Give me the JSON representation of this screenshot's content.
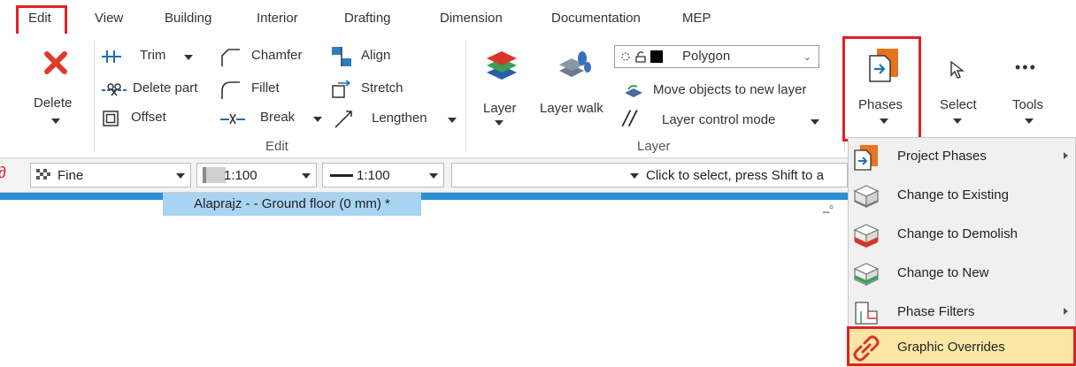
{
  "tabs": [
    "Edit",
    "View",
    "Building",
    "Interior",
    "Drafting",
    "Dimension",
    "Documentation",
    "MEP"
  ],
  "ribbon": {
    "delete_label": "Delete",
    "trim": "Trim",
    "delete_part": "Delete part",
    "offset": "Offset",
    "chamfer": "Chamfer",
    "fillet": "Fillet",
    "break": "Break",
    "align": "Align",
    "stretch": "Stretch",
    "lengthen": "Lengthen",
    "edit_group": "Edit",
    "layer": "Layer",
    "layer_walk": "Layer walk",
    "polygon": "Polygon",
    "move_objects": "Move objects to new layer",
    "layer_control": "Layer control mode",
    "layer_group": "Layer",
    "phases": "Phases",
    "select": "Select",
    "tools": "Tools",
    "tools_dots": "•••"
  },
  "toolbar": {
    "quality": "Fine",
    "scale1": "1:100",
    "scale2": "1:100",
    "blank": "",
    "hint": "Click to select, press Shift to a"
  },
  "view_tab": "Alaprajz -  - Ground floor (0 mm) *",
  "menu": {
    "items": [
      {
        "label": "Project Phases",
        "icon": "project-phases-icon",
        "submenu": true
      },
      {
        "label": "Change to Existing",
        "icon": "existing-box-icon",
        "submenu": false
      },
      {
        "label": "Change to Demolish",
        "icon": "demolish-box-icon",
        "submenu": false
      },
      {
        "label": "Change to New",
        "icon": "new-box-icon",
        "submenu": false
      },
      {
        "label": "Phase Filters",
        "icon": "phase-filters-icon",
        "submenu": true
      },
      {
        "label": "Graphic Overrides",
        "icon": "link-icon",
        "submenu": false
      }
    ]
  },
  "colors": {
    "highlight_box": "#e0202a",
    "menu_hover": "#fbe7a5",
    "view_tab_strip": "#2b8fd6",
    "phase_icon_orange": "#e8731e"
  }
}
